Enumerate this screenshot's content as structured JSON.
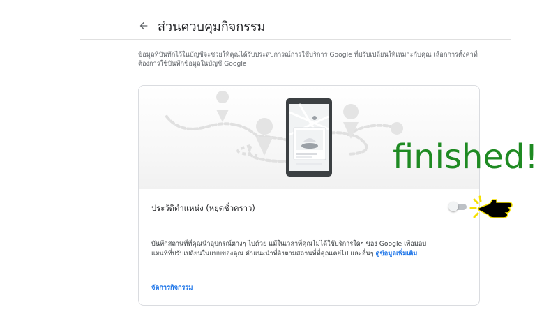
{
  "header": {
    "title": "ส่วนควบคุมกิจกรรม",
    "back_icon": "arrow-back-icon"
  },
  "intro": {
    "text": "ข้อมูลที่บันทึกไว้ในบัญชีจะช่วยให้คุณได้รับประสบการณ์การใช้บริการ Google ที่ปรับเปลี่ยนให้เหมาะกับคุณ เลือกการตั้งค่าที่ต้องการใช้บันทึกข้อมูลในบัญชี Google"
  },
  "card": {
    "setting": {
      "label": "ประวัติตำแหน่ง (หยุดชั่วคราว)",
      "enabled": false
    },
    "description_text": "บันทึกสถานที่ที่คุณนำอุปกรณ์ต่างๆ ไปด้วย แม้ในเวลาที่คุณไม่ได้ใช้บริการใดๆ ของ Google เพื่อมอบแผนที่ที่ปรับเปลี่ยนในแบบของคุณ คำแนะนำที่อิงตามสถานที่ที่คุณเคยไป และอื่นๆ ",
    "learn_more": "ดูข้อมูลเพิ่มเติม",
    "manage_link": "จัดการกิจกรรม"
  },
  "overlay": {
    "finished_text": "finished!",
    "finished_color": "#1e8a22",
    "cursor_icon": "pointing-hand-cursor-icon"
  },
  "colors": {
    "link": "#1a73e8",
    "toggle_off_track": "#bdc1c6",
    "divider": "#e0e0e0"
  }
}
